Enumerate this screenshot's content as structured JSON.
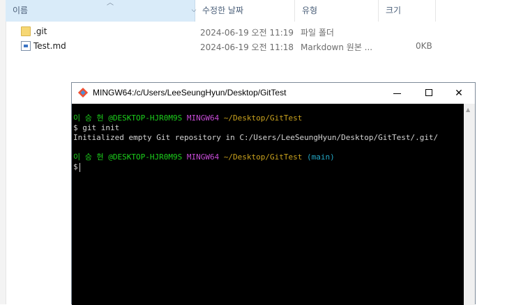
{
  "explorer": {
    "columns": {
      "name": "이름",
      "date": "수정한 날짜",
      "type": "유형",
      "size": "크기"
    },
    "files": [
      {
        "icon": "folder-icon",
        "name": ".git",
        "date": "2024-06-19 오전 11:19",
        "type": "파일 폴더",
        "size": ""
      },
      {
        "icon": "markdown-file-icon",
        "name": "Test.md",
        "date": "2024-06-19 오전 11:18",
        "type": "Markdown 원본 ...",
        "size": "0KB"
      }
    ]
  },
  "terminal": {
    "title": "MINGW64:/c/Users/LeeSeungHyun/Desktop/GitTest",
    "colors": {
      "user": "#1cd01c",
      "env": "#c64bd6",
      "path": "#c9a21e",
      "branch": "#23a8c6",
      "text": "#d4d4d4"
    },
    "prompt1": {
      "user": "이 승 현 @DESKTOP-HJR0M9S",
      "env": "MINGW64",
      "path": "~/Desktop/GitTest"
    },
    "cmd1": "$ git init",
    "output1": "Initialized empty Git repository in C:/Users/LeeSeungHyun/Desktop/GitTest/.git/",
    "prompt2": {
      "user": "이 승 현 @DESKTOP-HJR0M9S",
      "env": "MINGW64",
      "path": "~/Desktop/GitTest",
      "branch": "(main)"
    },
    "cmd2": "$"
  }
}
